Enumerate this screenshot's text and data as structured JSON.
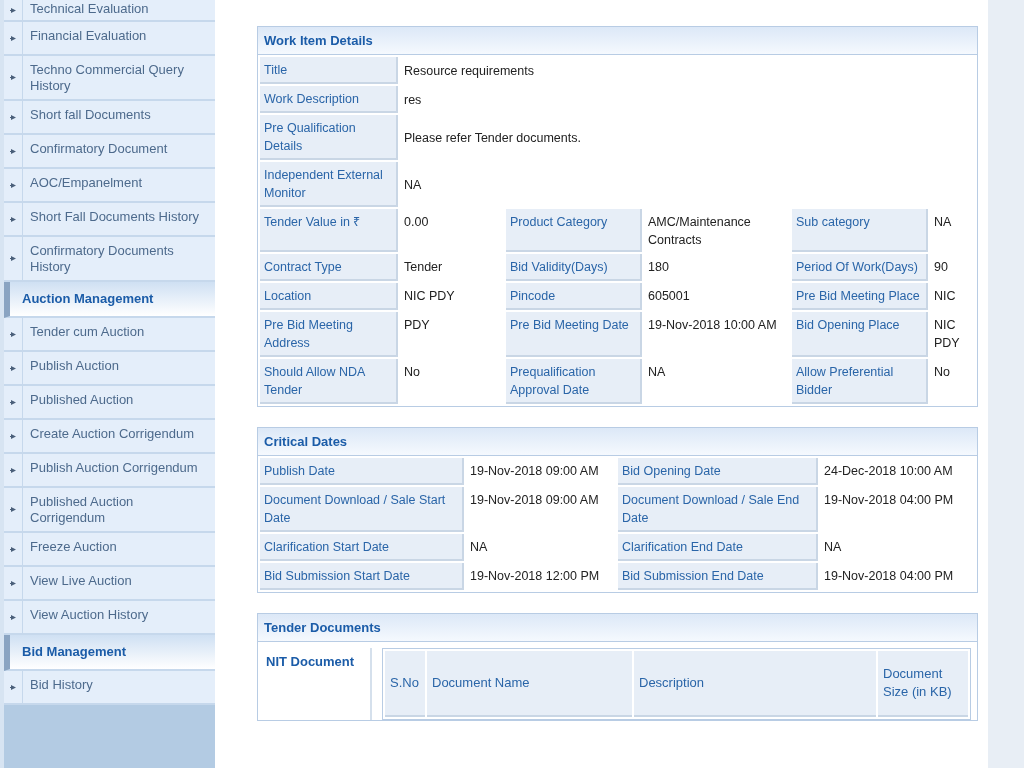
{
  "sidebar": {
    "items": [
      {
        "kind": "item",
        "label": "Technical Evaluation"
      },
      {
        "kind": "item",
        "label": "Financial Evaluation"
      },
      {
        "kind": "item",
        "label": "Techno Commercial Query History"
      },
      {
        "kind": "item",
        "label": "Short fall Documents"
      },
      {
        "kind": "item",
        "label": "Confirmatory Document"
      },
      {
        "kind": "item",
        "label": "AOC/Empanelment"
      },
      {
        "kind": "item",
        "label": "Short Fall Documents History"
      },
      {
        "kind": "item",
        "label": "Confirmatory Documents History"
      },
      {
        "kind": "header",
        "label": "Auction Management"
      },
      {
        "kind": "item",
        "label": "Tender cum Auction"
      },
      {
        "kind": "item",
        "label": "Publish Auction"
      },
      {
        "kind": "item",
        "label": "Published Auction"
      },
      {
        "kind": "item",
        "label": "Create Auction Corrigendum"
      },
      {
        "kind": "item",
        "label": "Publish Auction Corrigendum"
      },
      {
        "kind": "item",
        "label": "Published Auction Corrigendum"
      },
      {
        "kind": "item",
        "label": "Freeze Auction"
      },
      {
        "kind": "item",
        "label": "View Live Auction"
      },
      {
        "kind": "item",
        "label": "View Auction History"
      },
      {
        "kind": "header",
        "label": "Bid Management"
      },
      {
        "kind": "item",
        "label": "Bid History"
      }
    ]
  },
  "work_item_details": {
    "title": "Work Item Details",
    "rows": [
      [
        {
          "label": "Title",
          "value": "Resource requirements"
        }
      ],
      [
        {
          "label": "Work Description",
          "value": "res"
        }
      ],
      [
        {
          "label": "Pre Qualification Details",
          "value": "Please refer Tender documents."
        }
      ],
      [
        {
          "label": "Independent External Monitor",
          "value": "NA"
        }
      ],
      [
        {
          "label": "Tender Value in ₹",
          "value": "0.00"
        },
        {
          "label": "Product Category",
          "value": "AMC/Maintenance Contracts"
        },
        {
          "label": "Sub category",
          "value": "NA"
        }
      ],
      [
        {
          "label": "Contract Type",
          "value": "Tender"
        },
        {
          "label": "Bid Validity(Days)",
          "value": "180"
        },
        {
          "label": "Period Of Work(Days)",
          "value": "90"
        }
      ],
      [
        {
          "label": "Location",
          "value": "NIC PDY"
        },
        {
          "label": "Pincode",
          "value": "605001"
        },
        {
          "label": "Pre Bid Meeting Place",
          "value": "NIC"
        }
      ],
      [
        {
          "label": "Pre Bid Meeting Address",
          "value": "PDY"
        },
        {
          "label": "Pre Bid Meeting Date",
          "value": "19-Nov-2018 10:00 AM"
        },
        {
          "label": "Bid Opening Place",
          "value": "NIC PDY"
        }
      ],
      [
        {
          "label": "Should Allow NDA Tender",
          "value": "No"
        },
        {
          "label": "Prequalification Approval Date",
          "value": "NA"
        },
        {
          "label": "Allow Preferential Bidder",
          "value": "No"
        }
      ]
    ]
  },
  "critical_dates": {
    "title": "Critical Dates",
    "rows": [
      [
        {
          "label": "Publish Date",
          "value": "19-Nov-2018 09:00 AM"
        },
        {
          "label": "Bid Opening Date",
          "value": "24-Dec-2018 10:00 AM"
        }
      ],
      [
        {
          "label": "Document Download / Sale Start Date",
          "value": "19-Nov-2018 09:00 AM"
        },
        {
          "label": "Document Download / Sale End Date",
          "value": "19-Nov-2018 04:00 PM"
        }
      ],
      [
        {
          "label": "Clarification Start Date",
          "value": "NA"
        },
        {
          "label": "Clarification End Date",
          "value": "NA"
        }
      ],
      [
        {
          "label": "Bid Submission Start Date",
          "value": "19-Nov-2018 12:00 PM"
        },
        {
          "label": "Bid Submission End Date",
          "value": "19-Nov-2018 04:00 PM"
        }
      ]
    ]
  },
  "tender_documents": {
    "title": "Tender Documents",
    "nit_label": "NIT Document",
    "columns": [
      "S.No",
      "Document Name",
      "Description",
      "Document Size (in KB)"
    ]
  }
}
